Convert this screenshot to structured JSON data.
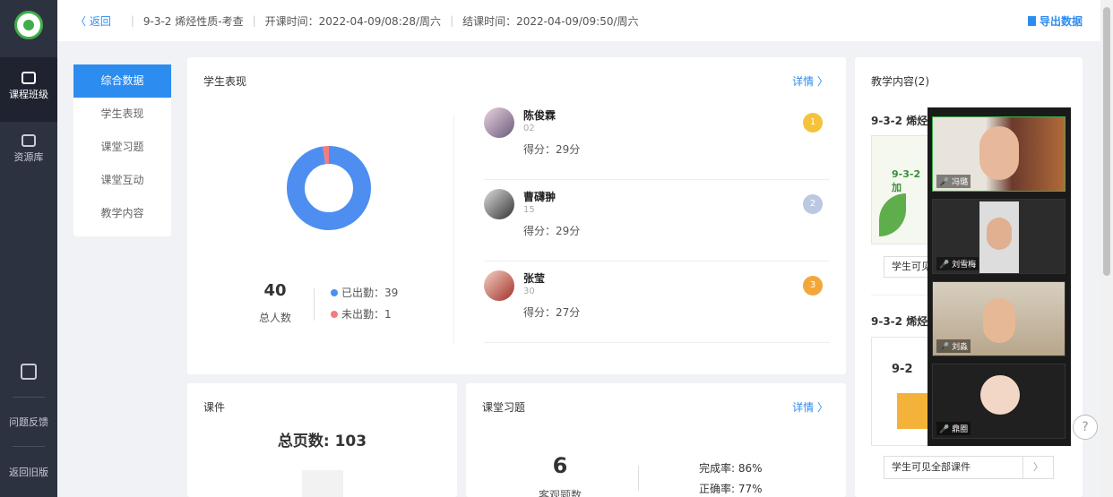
{
  "sidebar": {
    "items": [
      {
        "label": "课程班级"
      },
      {
        "label": "资源库"
      },
      {
        "label": "问题反馈"
      },
      {
        "label": "返回旧版"
      }
    ]
  },
  "topbar": {
    "back": "〈 返回",
    "course": "9-3-2 烯烃性质-考查",
    "start": "开课时间：2022-04-09/08:28/周六",
    "end": "结课时间：2022-04-09/09:50/周六",
    "export": "导出数据"
  },
  "subnav": [
    "综合数据",
    "学生表现",
    "课堂习题",
    "课堂互动",
    "教学内容"
  ],
  "performance": {
    "title": "学生表现",
    "detail": "详情 〉",
    "total": "40",
    "total_label": "总人数",
    "present_label": "已出勤：39",
    "absent_label": "未出勤：1",
    "present": 39,
    "absent": 1,
    "colors": {
      "present": "#4d8ef0",
      "absent": "#f47c7c"
    },
    "ranking": [
      {
        "name": "陈俊霖",
        "no": "02",
        "score": "得分：29分",
        "medal": "1"
      },
      {
        "name": "曹礴翀",
        "no": "15",
        "score": "得分：29分",
        "medal": "2"
      },
      {
        "name": "张莹",
        "no": "30",
        "score": "得分：27分",
        "medal": "3"
      }
    ]
  },
  "teaching": {
    "title": "教学内容(2)",
    "item1": "9-3-2 烯烃",
    "item1_thumb": "9-3-2 加",
    "item2": "9-3-2 烯烃",
    "item2_thumb": "9-2",
    "visible_btn": "学生可见",
    "visible_all": "学生可见全部课件",
    "arrow": "〉"
  },
  "courseware": {
    "title": "课件",
    "pages": "总页数: 103"
  },
  "exercise": {
    "title": "课堂习题",
    "detail": "详情 〉",
    "count": "6",
    "count_label": "客观题数",
    "completion": "完成率: 86%",
    "accuracy": "正确率: 77%"
  },
  "video": {
    "participants": [
      "冯璐",
      "刘雪梅",
      "刘淼",
      "鼎圈"
    ]
  },
  "help": "?"
}
